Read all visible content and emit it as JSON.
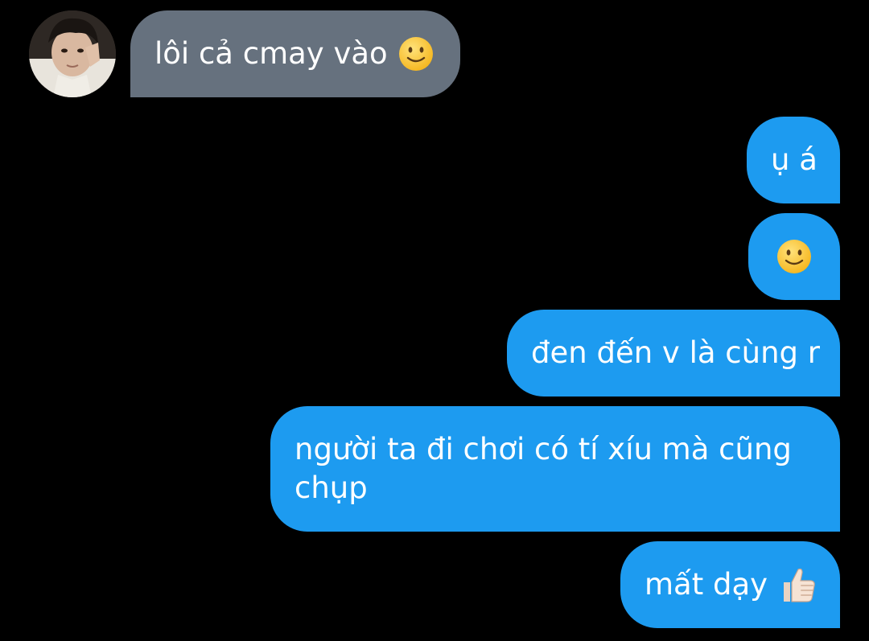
{
  "contact": {
    "avatar_icon": "user-avatar-photo"
  },
  "messages": [
    {
      "direction": "incoming",
      "text": "lôi cả cmay vào",
      "emoji": "slightly-smiling-face-icon"
    },
    {
      "direction": "outgoing",
      "text": "ụ á"
    },
    {
      "direction": "outgoing",
      "text": "",
      "emoji": "slightly-smiling-face-icon"
    },
    {
      "direction": "outgoing",
      "text": "đen đến v là cùng r"
    },
    {
      "direction": "outgoing",
      "text": "người ta đi chơi có tí xíu mà cũng chụp"
    },
    {
      "direction": "outgoing",
      "text": "mất dạy",
      "emoji": "thumbs-up-icon"
    }
  ],
  "colors": {
    "background": "#000000",
    "incoming_bubble": "#66717e",
    "outgoing_bubble": "#1d9bf0",
    "text": "#ffffff"
  }
}
